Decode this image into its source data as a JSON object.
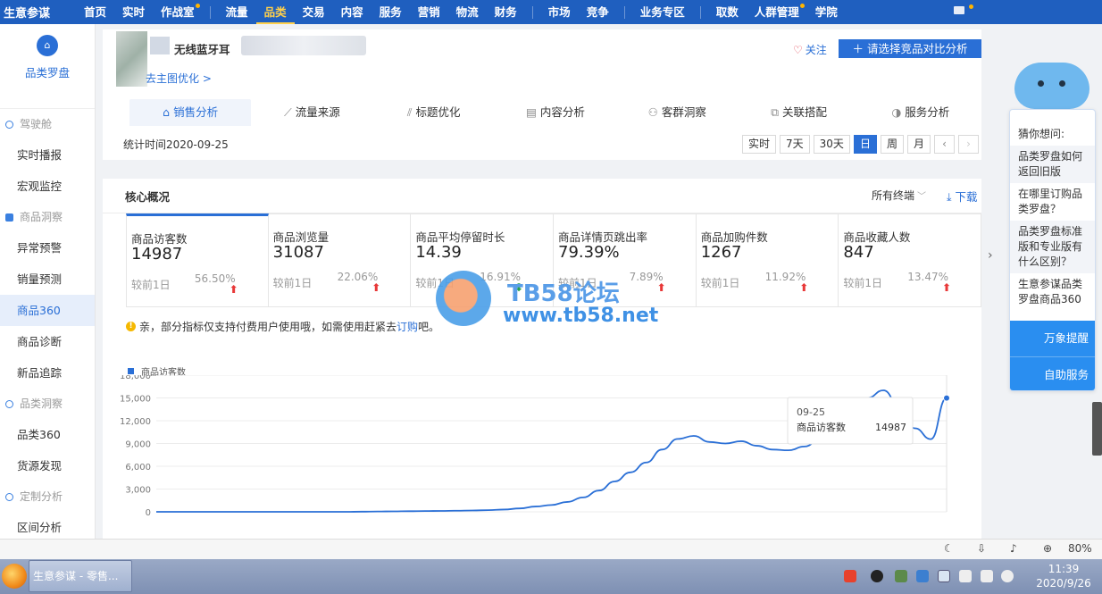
{
  "topnav": {
    "logo": "生意参谋",
    "items": [
      {
        "label": "首页"
      },
      {
        "label": "实时"
      },
      {
        "label": "作战室",
        "dot": true
      },
      {
        "label": "流量"
      },
      {
        "label": "品类",
        "active": true
      },
      {
        "label": "交易"
      },
      {
        "label": "内容"
      },
      {
        "label": "服务"
      },
      {
        "label": "营销"
      },
      {
        "label": "物流"
      },
      {
        "label": "财务"
      },
      {
        "label": "市场"
      },
      {
        "label": "竞争"
      },
      {
        "label": "业务专区"
      },
      {
        "label": "取数"
      },
      {
        "label": "人群管理",
        "dot": true
      },
      {
        "label": "学院"
      }
    ]
  },
  "sidebar": {
    "brand": "品类罗盘",
    "groups": [
      {
        "label": "驾驶舱",
        "items": [
          "实时播报",
          "宏观监控"
        ]
      },
      {
        "label": "商品洞察",
        "items": [
          "异常预警",
          "销量预测",
          "商品360",
          "商品诊断",
          "新品追踪"
        ]
      },
      {
        "label": "品类洞察",
        "items": [
          "品类360",
          "货源发现"
        ]
      },
      {
        "label": "定制分析",
        "items": [
          "区间分析"
        ]
      }
    ],
    "active_item": "商品360"
  },
  "product": {
    "name": "无线蓝牙耳",
    "link": "去主图优化 >",
    "follow": "关注",
    "compare_button": "请选择竞品对比分析"
  },
  "tabs": [
    "销售分析",
    "流量来源",
    "标题优化",
    "内容分析",
    "客群洞察",
    "关联搭配",
    "服务分析"
  ],
  "stat_time": "统计时间2020-09-25",
  "time_buttons": [
    "实时",
    "7天",
    "30天",
    "日",
    "周",
    "月"
  ],
  "time_active": "日",
  "core": {
    "title": "核心概况",
    "terminals": "所有终端",
    "download": "下载",
    "metrics": [
      {
        "label": "商品访客数",
        "value": "14987",
        "cmp": "较前1日",
        "pct": "56.50%",
        "trend": "up"
      },
      {
        "label": "商品浏览量",
        "value": "31087",
        "cmp": "较前1日",
        "pct": "22.06%",
        "trend": "up"
      },
      {
        "label": "商品平均停留时长",
        "value": "14.39",
        "cmp": "较前1日",
        "pct": "16.91%",
        "trend": "down"
      },
      {
        "label": "商品详情页跳出率",
        "value": "79.39%",
        "cmp": "较前1日",
        "pct": "7.89%",
        "trend": "up"
      },
      {
        "label": "商品加购件数",
        "value": "1267",
        "cmp": "较前1日",
        "pct": "11.92%",
        "trend": "up"
      },
      {
        "label": "商品收藏人数",
        "value": "847",
        "cmp": "较前1日",
        "pct": "13.47%",
        "trend": "up"
      }
    ],
    "notice_prefix": "亲，部分指标仅支持付费用户使用哦，如需使用赶紧去",
    "notice_link": "订购",
    "notice_suffix": "吧。"
  },
  "chart_data": {
    "type": "line",
    "series": [
      {
        "name": "商品访客数",
        "values": [
          0,
          0,
          0,
          0,
          0,
          0,
          0,
          0,
          0,
          0,
          0,
          0,
          0,
          20,
          40,
          60,
          80,
          100,
          120,
          150,
          180,
          220,
          300,
          450,
          700,
          900,
          1300,
          1900,
          2800,
          4000,
          5200,
          6500,
          8200,
          9600,
          10000,
          9200,
          9000,
          9300,
          8700,
          8200,
          8100,
          8600,
          9500,
          10500,
          12000,
          15000,
          16000,
          14000,
          11000,
          9577,
          14987
        ]
      }
    ],
    "tooltip": {
      "date": "09-25",
      "label": "商品访客数",
      "value": "14987"
    },
    "yticks": [
      "18,000",
      "15,000",
      "12,000",
      "9,000",
      "6,000",
      "3,000",
      "0"
    ],
    "ylim": [
      0,
      18000
    ]
  },
  "helper": {
    "title": "猜你想问:",
    "questions": [
      "品类罗盘如何返回旧版",
      "在哪里订购品类罗盘？",
      "品类罗盘标准版和专业版有什么区别？",
      "生意参谋品类罗盘商品360"
    ],
    "buttons": [
      "万象提醒",
      "自助服务"
    ]
  },
  "statusbar": {
    "zoom": "80%"
  },
  "taskbar": {
    "app": "生意参谋 - 零售...",
    "time": "11:39",
    "date": "2020/9/26"
  },
  "watermark": {
    "line1": "TB58论坛",
    "line2": "www.tb58.net"
  },
  "colors": {
    "nav": "#1f5fbf",
    "accent": "#2a6fd6",
    "up": "#e83838",
    "down": "#22a04a",
    "nav_active": "#ffd04b"
  }
}
